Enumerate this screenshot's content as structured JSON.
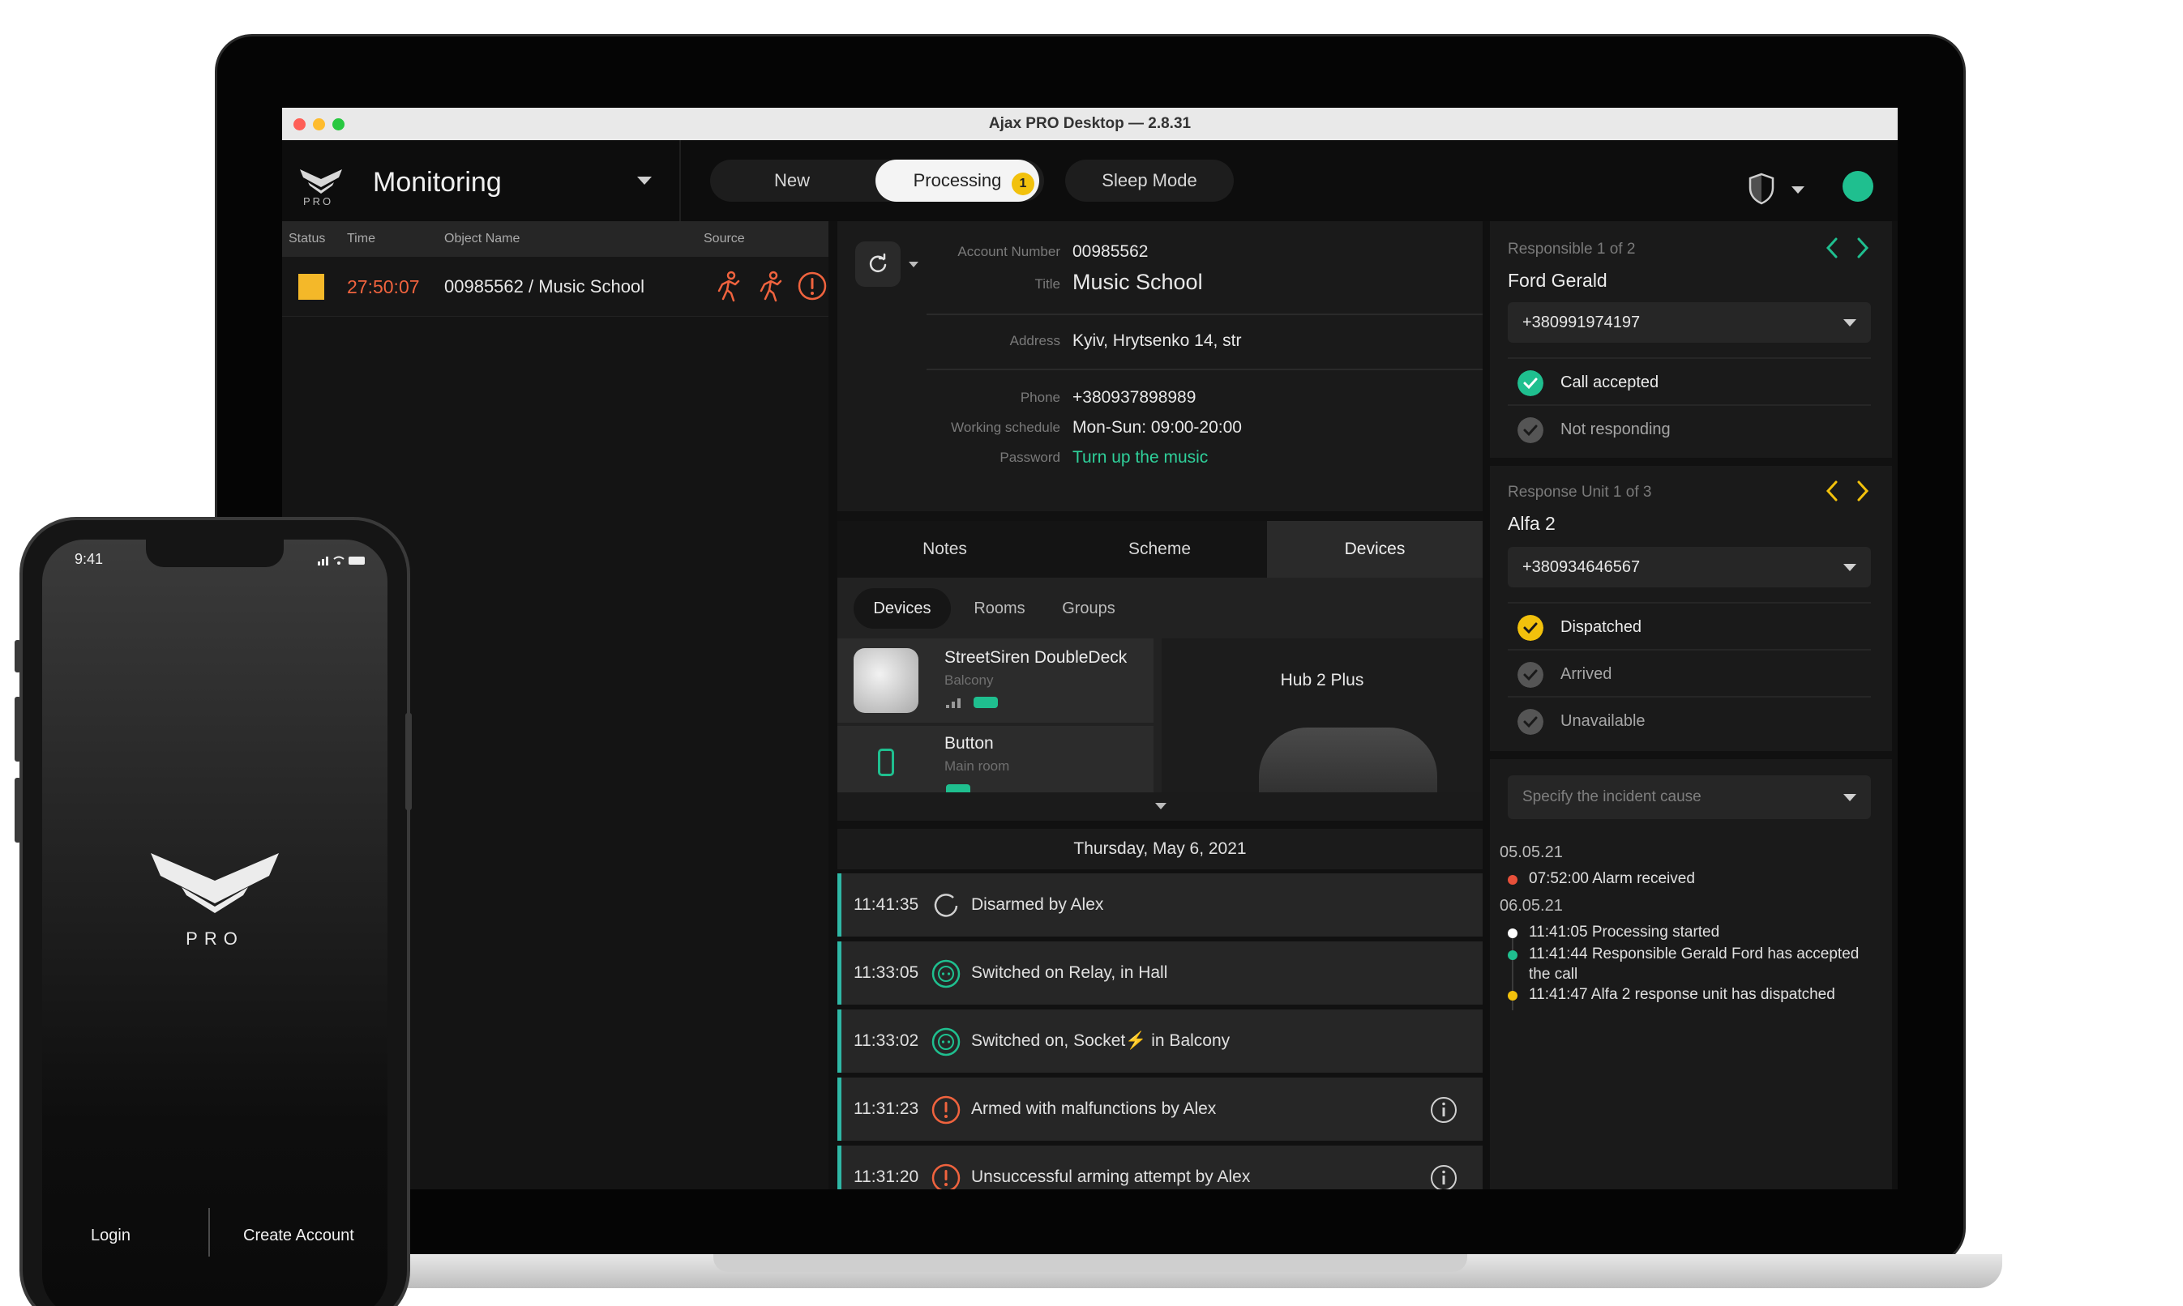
{
  "window": {
    "title": "Ajax PRO Desktop — 2.8.31"
  },
  "header": {
    "logo_text": "PRO",
    "title": "Monitoring",
    "tabs": [
      {
        "label": "New"
      },
      {
        "label": "Processing",
        "badge": "1"
      },
      {
        "label": "Sleep Mode"
      }
    ]
  },
  "event_list": {
    "columns": [
      "Status",
      "Time",
      "Object Name",
      "Source"
    ],
    "rows": [
      {
        "time": "27:50:07",
        "object": "00985562 / Music School",
        "status_color": "#f4b829"
      }
    ]
  },
  "object_info": {
    "fields": [
      {
        "label": "Account Number",
        "value": "00985562"
      },
      {
        "label": "Title",
        "value": "Music School"
      },
      {
        "label": "Address",
        "value": "Kyiv, Hrytsenko 14, str"
      },
      {
        "label": "Phone",
        "value": "+380937898989"
      },
      {
        "label": "Working schedule",
        "value": "Mon-Sun: 09:00-20:00"
      },
      {
        "label": "Password",
        "value": "Turn up the music"
      }
    ]
  },
  "info_tabs": [
    "Notes",
    "Scheme",
    "Devices"
  ],
  "devices_panel": {
    "sub_tabs": [
      "Devices",
      "Rooms",
      "Groups"
    ],
    "devices": [
      {
        "name": "StreetSiren DoubleDeck",
        "room": "Balcony"
      },
      {
        "name": "Button",
        "room": "Main room"
      }
    ],
    "hub": "Hub 2 Plus"
  },
  "event_log": {
    "date": "Thursday, May 6, 2021",
    "entries": [
      {
        "time": "11:41:35",
        "text": "Disarmed by Alex",
        "icon": "disarm-icon"
      },
      {
        "time": "11:33:05",
        "text": "Switched on Relay, in Hall",
        "icon": "relay-icon"
      },
      {
        "time": "11:33:02",
        "text": "Switched on, Socket⚡ in Balcony",
        "icon": "socket-icon"
      },
      {
        "time": "11:31:23",
        "text": "Armed with malfunctions by Alex",
        "icon": "warning-icon"
      },
      {
        "time": "11:31:20",
        "text": "Unsuccessful arming attempt by Alex",
        "icon": "warning-icon"
      }
    ]
  },
  "responsible": {
    "caption": "Responsible 1 of 2",
    "name": "Ford Gerald",
    "phone": "+380991974197",
    "statuses": [
      {
        "label": "Call accepted",
        "active": true,
        "color": "#1fbf8f"
      },
      {
        "label": "Not responding",
        "active": false,
        "color": "#555555"
      }
    ]
  },
  "response_unit": {
    "caption": "Response Unit 1 of 3",
    "name": "Alfa 2",
    "phone": "+380934646567",
    "statuses": [
      {
        "label": "Dispatched",
        "active": true,
        "color": "#f2c10c"
      },
      {
        "label": "Arrived",
        "active": false,
        "color": "#555555"
      },
      {
        "label": "Unavailable",
        "active": false,
        "color": "#555555"
      }
    ]
  },
  "incident": {
    "placeholder": "Specify the incident cause",
    "timeline": [
      {
        "date": "05.05.21",
        "items": [
          {
            "text": "07:52:00 Alarm received",
            "color": "#e8503a"
          }
        ]
      },
      {
        "date": "06.05.21",
        "items": [
          {
            "text": "11:41:05 Processing started",
            "color": "#ffffff"
          },
          {
            "text": "11:41:44 Responsible Gerald Ford has accepted the call",
            "color": "#1fbf8f"
          },
          {
            "text": "11:41:47 Alfa 2 response unit has dispatched",
            "color": "#f2c10c"
          }
        ]
      }
    ]
  },
  "phone": {
    "time": "9:41",
    "logo_text": "PRO",
    "login": "Login",
    "create_account": "Create Account"
  },
  "colors": {
    "accent": "#1fbf8f",
    "alert": "#f0633e",
    "warning": "#f2c10c"
  }
}
